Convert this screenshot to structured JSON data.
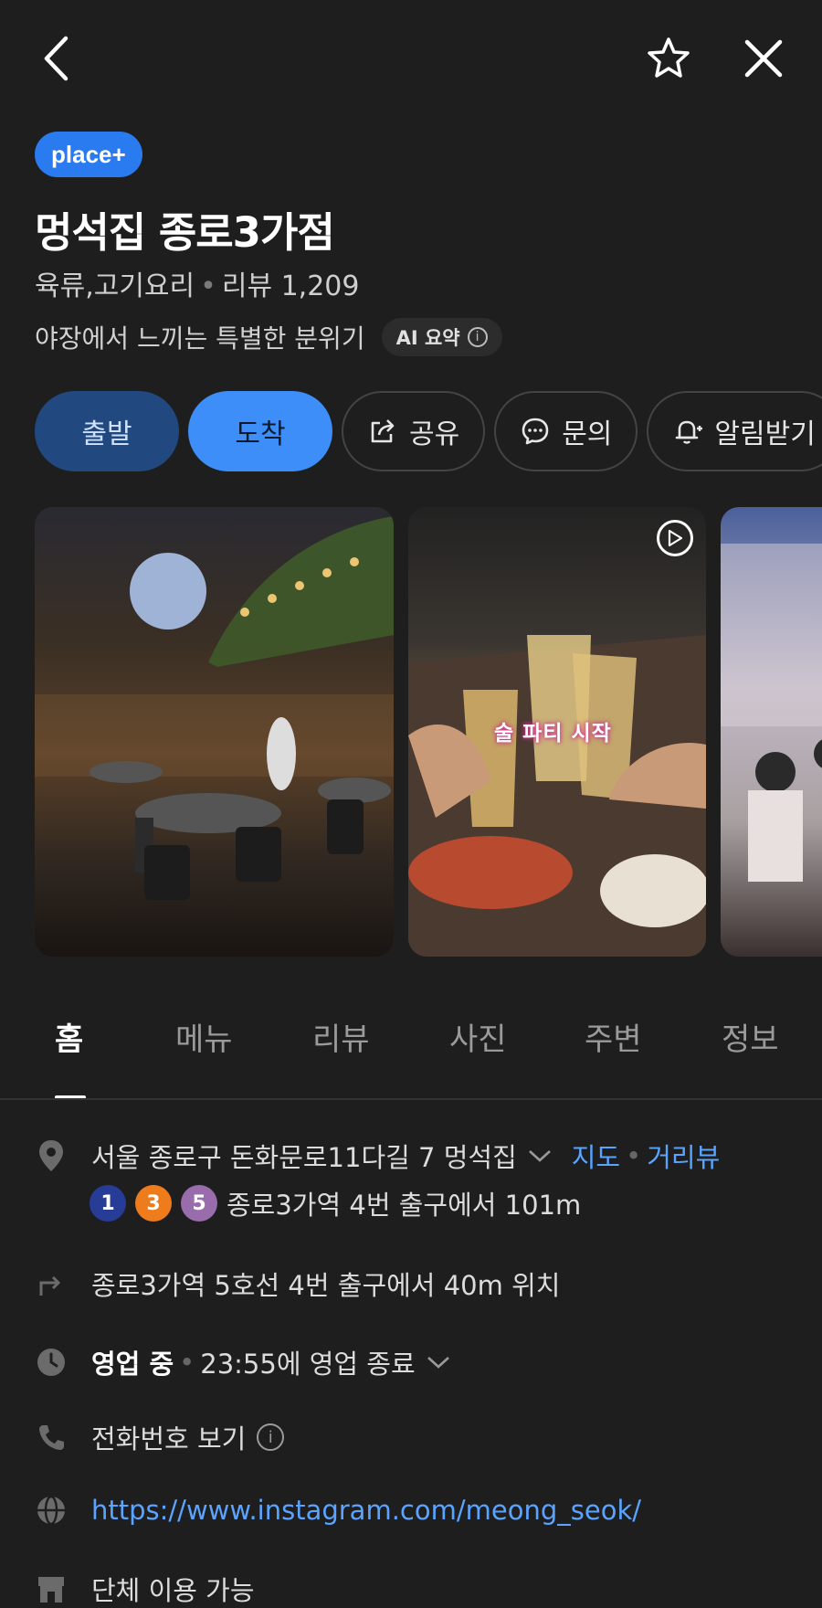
{
  "header": {
    "back_icon": "chevron-left-icon",
    "favorite_icon": "star-outline-icon",
    "close_icon": "close-icon"
  },
  "badge": {
    "label": "place+"
  },
  "place": {
    "name": "멍석집 종로3가점",
    "category": "육류,고기요리",
    "review_label": "리뷰 1,209",
    "tagline": "야장에서 느끼는 특별한 분위기",
    "ai_summary_label": "AI 요약"
  },
  "actions": {
    "depart": "출발",
    "arrive": "도착",
    "share": "공유",
    "inquiry": "문의",
    "notify": "알림받기"
  },
  "photos": {
    "video_caption": "술 파티 시작"
  },
  "tabs": [
    "홈",
    "메뉴",
    "리뷰",
    "사진",
    "주변",
    "정보"
  ],
  "info": {
    "address": "서울 종로구 돈화문로11다길 7 멍석집",
    "map_link": "지도",
    "street_view_link": "거리뷰",
    "subway_lines": [
      {
        "num": "1",
        "color": "#263c96"
      },
      {
        "num": "3",
        "color": "#ef7c1c"
      },
      {
        "num": "5",
        "color": "#996cac"
      }
    ],
    "subway_text": "종로3가역 4번 출구에서 101m",
    "directions_text": "종로3가역 5호선 4번 출구에서 40m 위치",
    "hours_status": "영업 중",
    "hours_detail": "23:55에 영업 종료",
    "phone_label": "전화번호 보기",
    "website": "https://www.instagram.com/meong_seok/",
    "group_label": "단체 이용 가능"
  }
}
